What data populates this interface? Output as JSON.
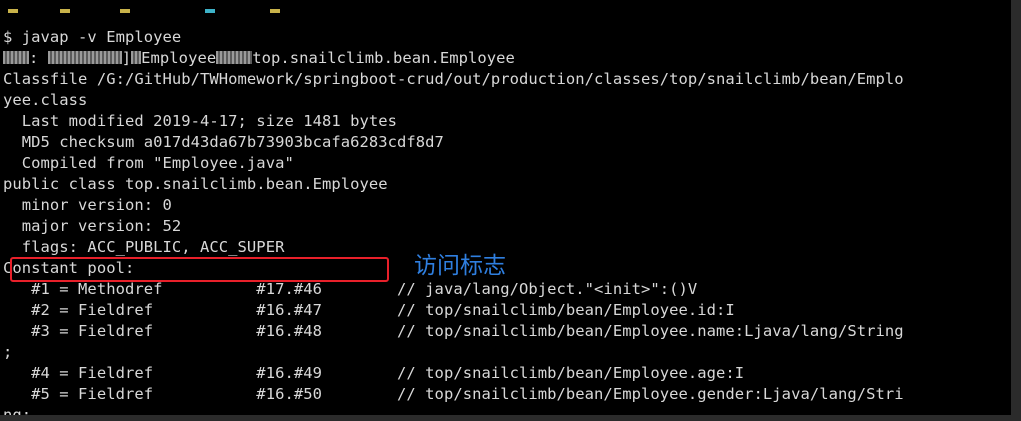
{
  "terminal": {
    "top_fragment": "(top of previous line cut off)",
    "lines": [
      "$ javap -v Employee",
      ": ]Employeetop.snailclimb.bean.Employee",
      "Classfile /G:/GitHub/TWHomework/springboot-crud/out/production/classes/top/snailclimb/bean/Emplo",
      "yee.class",
      "  Last modified 2019-4-17; size 1481 bytes",
      "  MD5 checksum a017d43da67b73903bcafa6283cdf8d7",
      "  Compiled from \"Employee.java\"",
      "public class top.snailclimb.bean.Employee",
      "  minor version: 0",
      "  major version: 52",
      "  flags: ACC_PUBLIC, ACC_SUPER",
      "Constant pool:",
      "   #1 = Methodref          #17.#46        // java/lang/Object.\"<init>\":()V",
      "   #2 = Fieldref           #16.#47        // top/snailclimb/bean/Employee.id:I",
      "   #3 = Fieldref           #16.#48        // top/snailclimb/bean/Employee.name:Ljava/lang/String",
      ";",
      "   #4 = Fieldref           #16.#49        // top/snailclimb/bean/Employee.age:I",
      "   #5 = Fieldref           #16.#50        // top/snailclimb/bean/Employee.gender:Ljava/lang/Stri",
      "ng;"
    ],
    "garbled_line": {
      "part_a": ": ",
      "part_b": "]",
      "part_c": "Employee",
      "part_d": "top.snailclimb.bean.Employee"
    }
  },
  "annotation": {
    "label": "访问标志",
    "color": "#2f7fe0",
    "box_color": "#e8202a"
  },
  "colors": {
    "terminal_bg": "#000000",
    "terminal_text": "#d8d8d8",
    "frame_bg": "#2b2b2b"
  }
}
